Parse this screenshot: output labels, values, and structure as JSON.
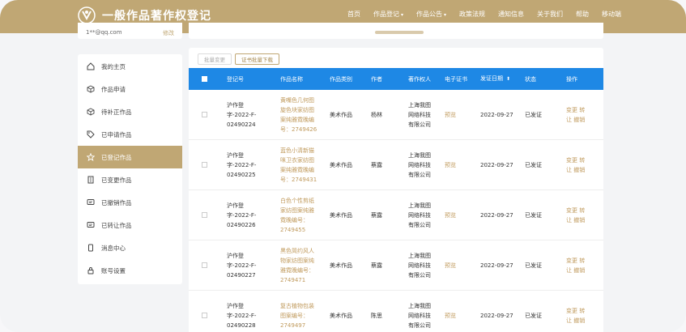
{
  "brand": {
    "title": "一般作品著作权登记",
    "color": "#c0a774"
  },
  "nav": [
    {
      "label": "首页",
      "caret": ""
    },
    {
      "label": "作品登记",
      "caret": "▾"
    },
    {
      "label": "作品公告",
      "caret": "▾"
    },
    {
      "label": "政策法规",
      "caret": ""
    },
    {
      "label": "通知信息",
      "caret": ""
    },
    {
      "label": "关于我们",
      "caret": ""
    },
    {
      "label": "帮助",
      "caret": ""
    },
    {
      "label": "移动端",
      "caret": ""
    }
  ],
  "profile": {
    "email": "1**@qq.com",
    "edit": "修改"
  },
  "sidebar": {
    "items": [
      {
        "label": "我的主页",
        "icon": "home-icon"
      },
      {
        "label": "作品申请",
        "icon": "cube-icon"
      },
      {
        "label": "待补正作品",
        "icon": "cube-icon"
      },
      {
        "label": "已申请作品",
        "icon": "tag-icon"
      },
      {
        "label": "已登记作品",
        "icon": "star-icon"
      },
      {
        "label": "已变更作品",
        "icon": "building-icon"
      },
      {
        "label": "已撤销作品",
        "icon": "message-icon"
      },
      {
        "label": "已转让作品",
        "icon": "message-icon"
      },
      {
        "label": "消息中心",
        "icon": "phone-icon"
      },
      {
        "label": "账号设置",
        "icon": "lock-icon"
      }
    ],
    "active_index": 4
  },
  "actions": {
    "batch_transfer": "批量变更",
    "batch_download": "证书批量下载"
  },
  "table": {
    "headers": {
      "reg": "登记号",
      "name": "作品名称",
      "category": "作品类别",
      "author": "作者",
      "owner": "著作权人",
      "cert": "电子证书",
      "date": "发证日期",
      "status": "状态",
      "op": "操作"
    },
    "sort_icon": "⬍",
    "rows": [
      {
        "reg": "沪作登\n字-2022-F-\n02490224",
        "name": "黄嘴色几何图\n旋色块家纺图\n案纯雅霓晚编\n号：2749426",
        "category": "美术作品",
        "author": "杨林",
        "owner": "上海我图\n网络科技\n有限公司",
        "cert": "预览",
        "date": "2022-09-27",
        "status": "已发证",
        "op": "变更 转\n让 撤销"
      },
      {
        "reg": "沪作登\n字-2022-F-\n02490225",
        "name": "蓝色小清新猫\n咪卫衣家纺图\n案纯雅霓晚编\n号：2749431",
        "category": "美术作品",
        "author": "蔡露",
        "owner": "上海我图\n网络科技\n有限公司",
        "cert": "预览",
        "date": "2022-09-27",
        "status": "已发证",
        "op": "变更 转\n让 撤销"
      },
      {
        "reg": "沪作登\n字-2022-F-\n02490226",
        "name": "白色个性剪纸\n家纺图案纯雅\n霓晚编号：\n2749455",
        "category": "美术作品",
        "author": "蔡露",
        "owner": "上海我图\n网络科技\n有限公司",
        "cert": "预览",
        "date": "2022-09-27",
        "status": "已发证",
        "op": "变更 转\n让 撤销"
      },
      {
        "reg": "沪作登\n字-2022-F-\n02490227",
        "name": "黑色简约风人\n物家纺图案纯\n雅霓晚编号：\n2749471",
        "category": "美术作品",
        "author": "蔡露",
        "owner": "上海我图\n网络科技\n有限公司",
        "cert": "预览",
        "date": "2022-09-27",
        "status": "已发证",
        "op": "变更 转\n让 撤销"
      },
      {
        "reg": "沪作登\n字-2022-F-\n02490228",
        "name": "复古植物包装\n图案编号：\n2749497",
        "category": "美术作品",
        "author": "陈思",
        "owner": "上海我图\n网络科技\n有限公司",
        "cert": "预览",
        "date": "2022-09-27",
        "status": "已发证",
        "op": "变更 转\n让 撤销"
      }
    ]
  },
  "colors": {
    "header_blue": "#1e88e5",
    "gold": "#c0a774",
    "link": "#c09a5c"
  }
}
